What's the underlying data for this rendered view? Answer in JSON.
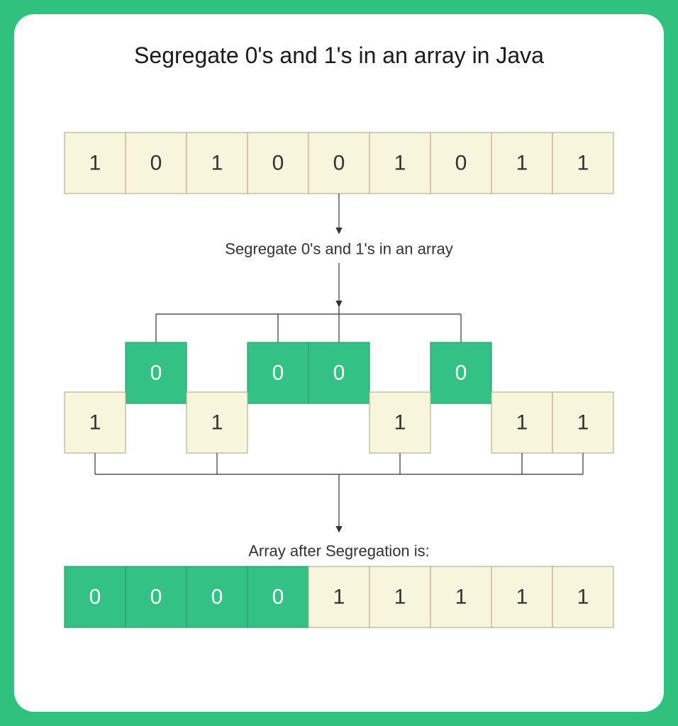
{
  "title": "Segregate 0's and 1's in an array in Java",
  "caption_mid": "Segregate 0's and 1's in an array",
  "caption_final": "Array after Segregation is:",
  "colors": {
    "green_border": "#2EC27E",
    "cream": "#F7F5DC",
    "cream_border": "#B5B38F",
    "green_cell": "#33C185",
    "green_cell_border": "#2A9E6D",
    "dark_text": "#333333",
    "white_text": "#FFFFFF",
    "line": "#333333"
  },
  "top_array": [
    "1",
    "0",
    "1",
    "0",
    "0",
    "1",
    "0",
    "1",
    "1"
  ],
  "middle": {
    "zeros_row": [
      {
        "pos": 1,
        "val": "0"
      },
      {
        "pos": 3,
        "val": "0"
      },
      {
        "pos": 4,
        "val": "0"
      },
      {
        "pos": 6,
        "val": "0"
      }
    ],
    "ones_row": [
      {
        "pos": 0,
        "val": "1"
      },
      {
        "pos": 2,
        "val": "1"
      },
      {
        "pos": 5,
        "val": "1"
      },
      {
        "pos": 7,
        "val": "1"
      },
      {
        "pos": 8,
        "val": "1"
      }
    ]
  },
  "bottom_array": [
    {
      "val": "0",
      "green": true
    },
    {
      "val": "0",
      "green": true
    },
    {
      "val": "0",
      "green": true
    },
    {
      "val": "0",
      "green": true
    },
    {
      "val": "1",
      "green": false
    },
    {
      "val": "1",
      "green": false
    },
    {
      "val": "1",
      "green": false
    },
    {
      "val": "1",
      "green": false
    },
    {
      "val": "1",
      "green": false
    }
  ]
}
